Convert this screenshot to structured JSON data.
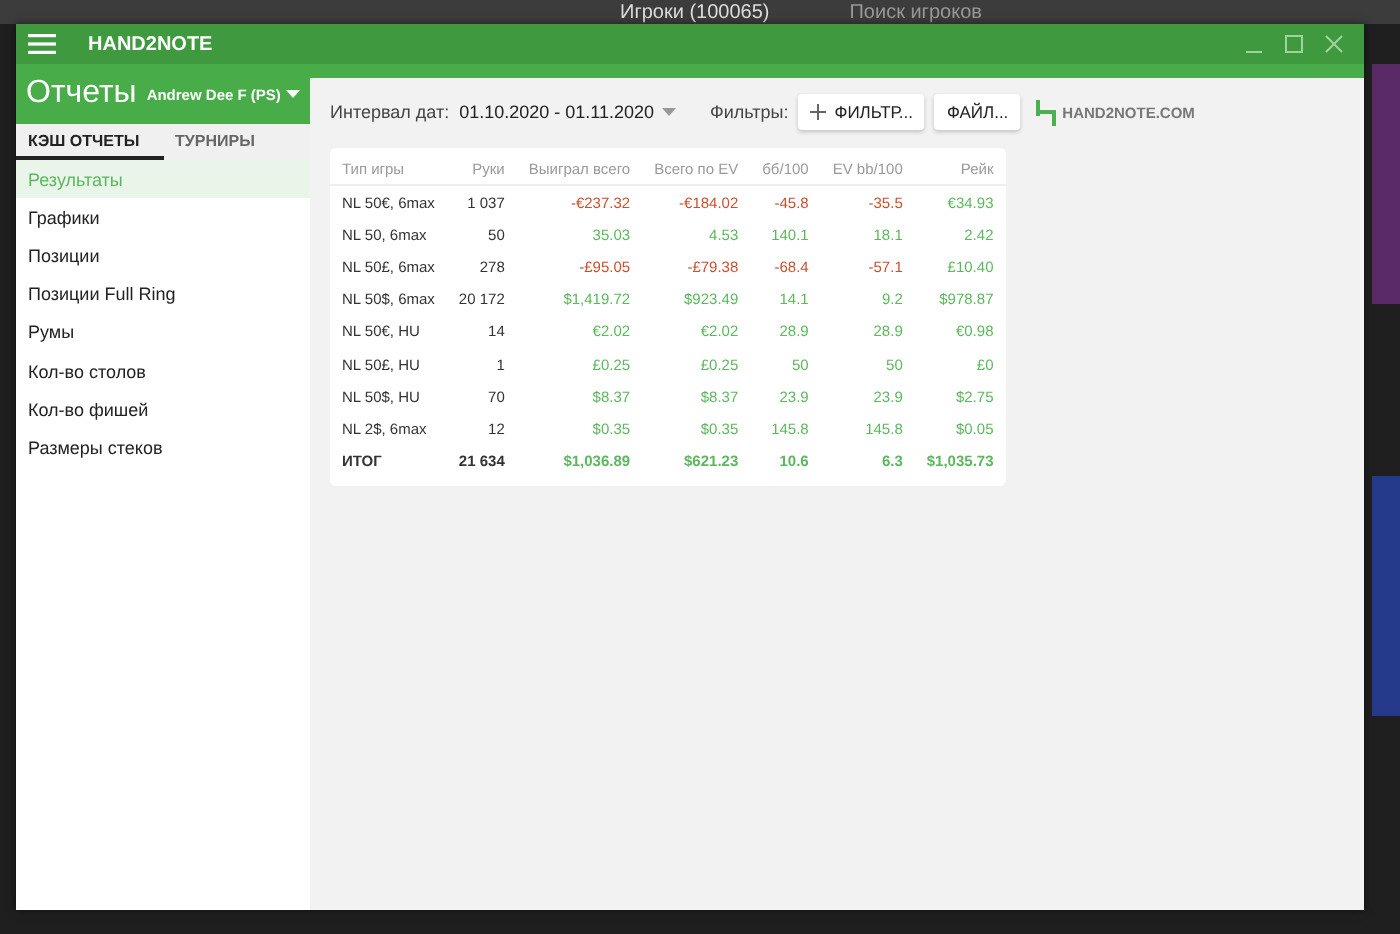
{
  "background_app": {
    "title": "Игроки (100065)",
    "search": {
      "placeholder": "Поиск игроков"
    }
  },
  "window": {
    "title": "HAND2NOTE"
  },
  "header": {
    "title": "Отчеты",
    "player": "Andrew Dee F (PS)"
  },
  "tabs": [
    {
      "label": "КЭШ ОТЧЕТЫ",
      "selected": true
    },
    {
      "label": "ТУРНИРЫ",
      "selected": false
    }
  ],
  "sidebar": {
    "items": [
      {
        "label": "Результаты",
        "selected": true
      },
      {
        "label": "Графики",
        "selected": false
      },
      {
        "label": "Позиции",
        "selected": false
      },
      {
        "label": "Позиции Full Ring",
        "selected": false
      },
      {
        "label": "Румы",
        "selected": false
      },
      {
        "label": "Кол-во столов",
        "selected": false
      },
      {
        "label": "Кол-во фишей",
        "selected": false
      },
      {
        "label": "Размеры стеков",
        "selected": false
      }
    ]
  },
  "toolbar": {
    "date_label": "Интервал дат:",
    "date_range": "01.10.2020 - 01.11.2020",
    "filters_label": "Фильтры:",
    "filter_button": "ФИЛЬТР...",
    "file_button": "ФАЙЛ...",
    "logo": "HAND2NOTE.COM"
  },
  "table": {
    "columns": [
      "Тип игры",
      "Руки",
      "Выиграл всего",
      "Всего по EV",
      "бб/100",
      "EV bb/100",
      "Рейк"
    ],
    "rows": [
      {
        "kind": "row",
        "cells": [
          {
            "text": "NL 50€, 6max",
            "kind": "plain"
          },
          {
            "text": "1 037",
            "kind": "plain"
          },
          {
            "text": "-€237.32",
            "kind": "loss"
          },
          {
            "text": "-€184.02",
            "kind": "loss"
          },
          {
            "text": "-45.8",
            "kind": "loss"
          },
          {
            "text": "-35.5",
            "kind": "loss"
          },
          {
            "text": "€34.93",
            "kind": "win"
          }
        ]
      },
      {
        "kind": "row",
        "cells": [
          {
            "text": "NL 50, 6max",
            "kind": "plain"
          },
          {
            "text": "50",
            "kind": "plain"
          },
          {
            "text": "35.03",
            "kind": "win"
          },
          {
            "text": "4.53",
            "kind": "win"
          },
          {
            "text": "140.1",
            "kind": "win"
          },
          {
            "text": "18.1",
            "kind": "win"
          },
          {
            "text": "2.42",
            "kind": "win"
          }
        ]
      },
      {
        "kind": "row",
        "cells": [
          {
            "text": "NL 50£, 6max",
            "kind": "plain"
          },
          {
            "text": "278",
            "kind": "plain"
          },
          {
            "text": "-£95.05",
            "kind": "loss"
          },
          {
            "text": "-£79.38",
            "kind": "loss"
          },
          {
            "text": "-68.4",
            "kind": "loss"
          },
          {
            "text": "-57.1",
            "kind": "loss"
          },
          {
            "text": "£10.40",
            "kind": "win"
          }
        ]
      },
      {
        "kind": "row",
        "cells": [
          {
            "text": "NL 50$, 6max",
            "kind": "plain"
          },
          {
            "text": "20 172",
            "kind": "plain"
          },
          {
            "text": "$1,419.72",
            "kind": "win"
          },
          {
            "text": "$923.49",
            "kind": "win"
          },
          {
            "text": "14.1",
            "kind": "win"
          },
          {
            "text": "9.2",
            "kind": "win"
          },
          {
            "text": "$978.87",
            "kind": "win"
          }
        ]
      },
      {
        "kind": "row",
        "cells": [
          {
            "text": "NL 50€, HU",
            "kind": "plain"
          },
          {
            "text": "14",
            "kind": "plain"
          },
          {
            "text": "€2.02",
            "kind": "win"
          },
          {
            "text": "€2.02",
            "kind": "win"
          },
          {
            "text": "28.9",
            "kind": "win"
          },
          {
            "text": "28.9",
            "kind": "win"
          },
          {
            "text": "€0.98",
            "kind": "win"
          }
        ]
      },
      {
        "kind": "row",
        "cells": [
          {
            "text": "NL 50£, HU",
            "kind": "plain"
          },
          {
            "text": "1",
            "kind": "plain"
          },
          {
            "text": "£0.25",
            "kind": "win"
          },
          {
            "text": "£0.25",
            "kind": "win"
          },
          {
            "text": "50",
            "kind": "win"
          },
          {
            "text": "50",
            "kind": "win"
          },
          {
            "text": "£0",
            "kind": "win"
          }
        ]
      },
      {
        "kind": "row",
        "cells": [
          {
            "text": "NL 50$, HU",
            "kind": "plain"
          },
          {
            "text": "70",
            "kind": "plain"
          },
          {
            "text": "$8.37",
            "kind": "win"
          },
          {
            "text": "$8.37",
            "kind": "win"
          },
          {
            "text": "23.9",
            "kind": "win"
          },
          {
            "text": "23.9",
            "kind": "win"
          },
          {
            "text": "$2.75",
            "kind": "win"
          }
        ]
      },
      {
        "kind": "row",
        "cells": [
          {
            "text": "NL 2$, 6max",
            "kind": "plain"
          },
          {
            "text": "12",
            "kind": "plain"
          },
          {
            "text": "$0.35",
            "kind": "win"
          },
          {
            "text": "$0.35",
            "kind": "win"
          },
          {
            "text": "145.8",
            "kind": "win"
          },
          {
            "text": "145.8",
            "kind": "win"
          },
          {
            "text": "$0.05",
            "kind": "win"
          }
        ]
      },
      {
        "kind": "total",
        "cells": [
          {
            "text": "ИТОГ",
            "kind": "plain"
          },
          {
            "text": "21 634",
            "kind": "plain"
          },
          {
            "text": "$1,036.89",
            "kind": "win"
          },
          {
            "text": "$621.23",
            "kind": "win"
          },
          {
            "text": "10.6",
            "kind": "win"
          },
          {
            "text": "6.3",
            "kind": "win"
          },
          {
            "text": "$1,035.73",
            "kind": "win"
          }
        ]
      }
    ]
  }
}
